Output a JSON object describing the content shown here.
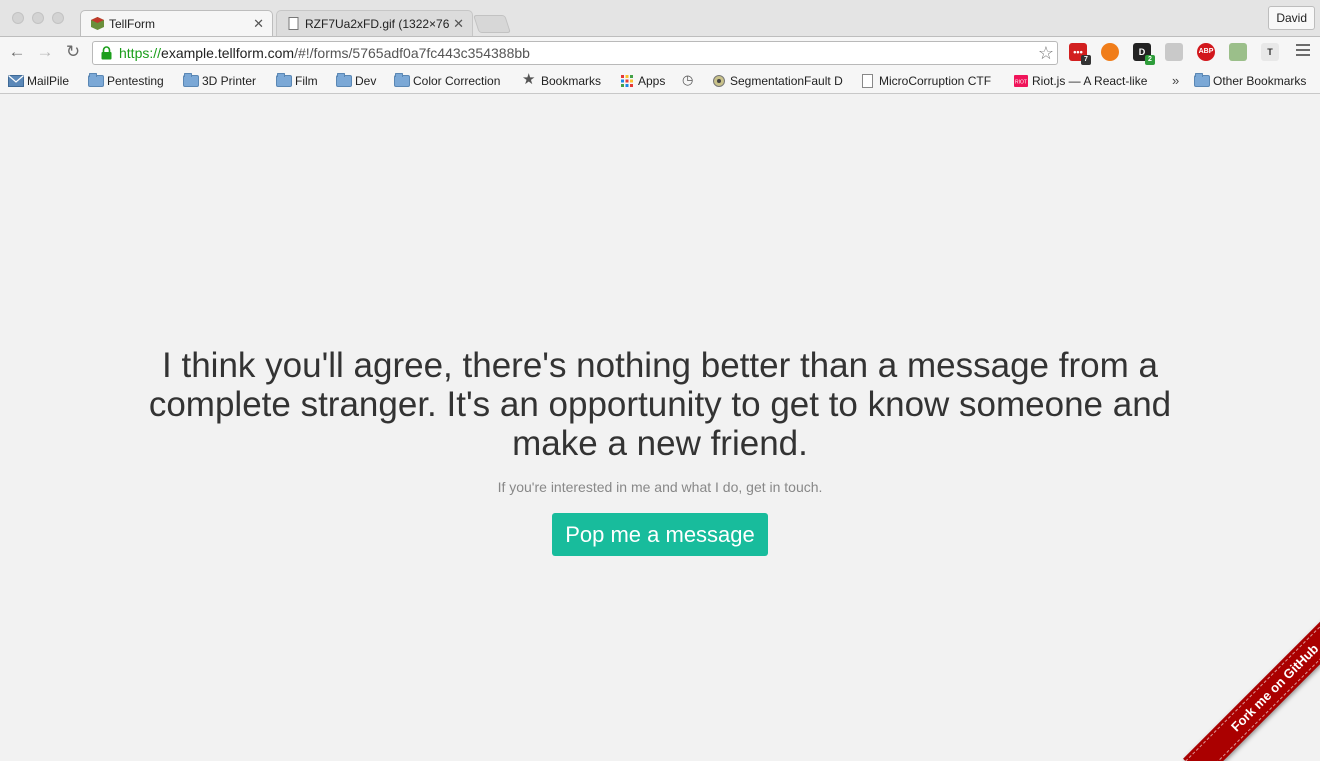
{
  "browser": {
    "tabs": [
      {
        "title": "TellForm",
        "active": true
      },
      {
        "title": "RZF7Ua2xFD.gif (1322×76",
        "active": false
      }
    ],
    "profile_name": "David",
    "url": {
      "scheme": "https://",
      "host": "example.tellform.com",
      "path": "/#!/forms/5765adf0a7fc443c354388bb"
    },
    "extensions": [
      {
        "name": "lastpass-icon",
        "label": "•••",
        "badge": "7",
        "color": "#d21f1f"
      },
      {
        "name": "hola-icon",
        "label": "",
        "badge": "",
        "color": "#f07d1a"
      },
      {
        "name": "d-extension-icon",
        "label": "D",
        "badge": "2",
        "color": "#222222"
      },
      {
        "name": "pocket-icon",
        "label": "",
        "badge": "",
        "color": "#c9c9c9"
      },
      {
        "name": "adblock-plus-icon",
        "label": "ABP",
        "badge": "",
        "color": "#d2171c"
      },
      {
        "name": "clipper-icon",
        "label": "",
        "badge": "",
        "color": "#9bbf8a"
      },
      {
        "name": "tampermonkey-icon",
        "label": "T",
        "badge": "",
        "color": "#e8e8e8"
      }
    ],
    "bookmarks": [
      {
        "label": "MailPile",
        "icon": "mail-icon"
      },
      {
        "label": "Pentesting",
        "icon": "folder-icon"
      },
      {
        "label": "3D Printer",
        "icon": "folder-icon"
      },
      {
        "label": "Film",
        "icon": "folder-icon"
      },
      {
        "label": "Dev",
        "icon": "folder-icon"
      },
      {
        "label": "Color Correction",
        "icon": "folder-icon"
      },
      {
        "label": "Bookmarks",
        "icon": "star-icon"
      },
      {
        "label": "Apps",
        "icon": "apps-grid-icon"
      },
      {
        "label": "",
        "icon": "history-icon"
      },
      {
        "label": "SegmentationFault D",
        "icon": "site-icon"
      },
      {
        "label": "MicroCorruption CTF",
        "icon": "page-icon"
      },
      {
        "label": "Riot.js — A React-like",
        "icon": "riot-icon"
      }
    ],
    "bookmarks_overflow": "»",
    "other_bookmarks": "Other Bookmarks"
  },
  "page": {
    "headline": "I think you'll agree, there's nothing better than a message from a complete stranger. It's an opportunity to get to know someone and make a new friend.",
    "subtext": "If you're interested in me and what I do, get in touch.",
    "cta_label": "Pop me a message",
    "cta_color": "#18bc9c",
    "ribbon_label": "Fork me on GitHub",
    "ribbon_color": "#aa0000"
  }
}
